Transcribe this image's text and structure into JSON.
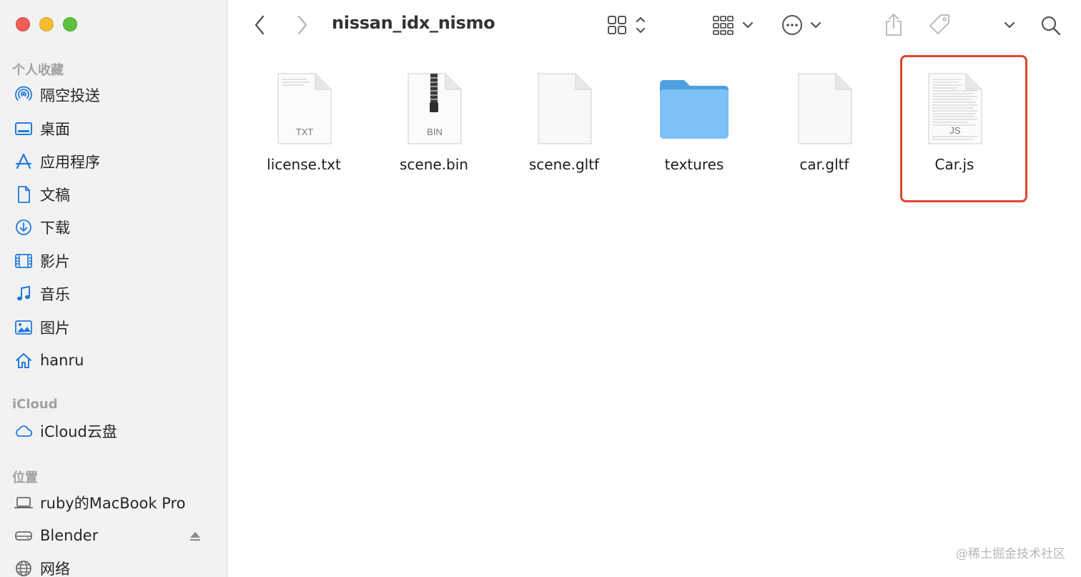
{
  "window": {
    "folder_title": "nissan_idx_nismo"
  },
  "sidebar": {
    "favorites_title": "个人收藏",
    "favorites": [
      {
        "label": "隔空投送",
        "icon": "airdrop-icon"
      },
      {
        "label": "桌面",
        "icon": "desktop-icon"
      },
      {
        "label": "应用程序",
        "icon": "applications-icon"
      },
      {
        "label": "文稿",
        "icon": "documents-icon"
      },
      {
        "label": "下载",
        "icon": "downloads-icon"
      },
      {
        "label": "影片",
        "icon": "movies-icon"
      },
      {
        "label": "音乐",
        "icon": "music-icon"
      },
      {
        "label": "图片",
        "icon": "pictures-icon"
      },
      {
        "label": "hanru",
        "icon": "home-icon"
      }
    ],
    "icloud_title": "iCloud",
    "icloud": [
      {
        "label": "iCloud云盘",
        "icon": "cloud-icon"
      }
    ],
    "locations_title": "位置",
    "locations": [
      {
        "label": "ruby的MacBook Pro",
        "icon": "laptop-icon"
      },
      {
        "label": "Blender",
        "icon": "disk-icon"
      },
      {
        "label": "网络",
        "icon": "network-icon"
      }
    ]
  },
  "files": [
    {
      "name": "license.txt",
      "kind": "TXT",
      "icon": "text-file-icon"
    },
    {
      "name": "scene.bin",
      "kind": "BIN",
      "icon": "zip-file-icon"
    },
    {
      "name": "scene.gltf",
      "kind": "",
      "icon": "blank-file-icon"
    },
    {
      "name": "textures",
      "kind": "",
      "icon": "folder-icon"
    },
    {
      "name": "car.gltf",
      "kind": "",
      "icon": "blank-file-icon"
    },
    {
      "name": "Car.js",
      "kind": "JS",
      "icon": "js-file-icon"
    }
  ],
  "colors": {
    "accent": "#1f7ae0",
    "highlight": "#e0442f",
    "folder": "#6fb8f2"
  },
  "watermark": "@稀土掘金技术社区"
}
